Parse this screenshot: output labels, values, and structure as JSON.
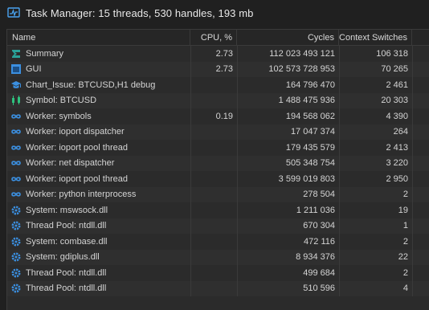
{
  "window": {
    "title": "Task Manager: 15 threads, 530 handles, 193 mb"
  },
  "columns": {
    "name": "Name",
    "cpu": "CPU, %",
    "cycles": "Cycles",
    "context_switches": "Context Switches"
  },
  "rows": [
    {
      "name": "Summary",
      "cpu": "2.73",
      "cycles": "112 023 493 121",
      "ctx": "106 318",
      "icon": "summary-icon"
    },
    {
      "name": "GUI",
      "cpu": "2.73",
      "cycles": "102 573 728 953",
      "ctx": "70 265",
      "icon": "gui-icon"
    },
    {
      "name": "Chart_Issue: BTCUSD,H1 debug",
      "cpu": "",
      "cycles": "164 796 470",
      "ctx": "2 461",
      "icon": "graduation-cap-icon"
    },
    {
      "name": "Symbol: BTCUSD",
      "cpu": "",
      "cycles": "1 488 475 936",
      "ctx": "20 303",
      "icon": "symbol-icon"
    },
    {
      "name": "Worker: symbols",
      "cpu": "0.19",
      "cycles": "194 568 062",
      "ctx": "4 390",
      "icon": "infinity-icon"
    },
    {
      "name": "Worker: ioport dispatcher",
      "cpu": "",
      "cycles": "17 047 374",
      "ctx": "264",
      "icon": "infinity-icon"
    },
    {
      "name": "Worker: ioport pool thread",
      "cpu": "",
      "cycles": "179 435 579",
      "ctx": "2 413",
      "icon": "infinity-icon"
    },
    {
      "name": "Worker: net dispatcher",
      "cpu": "",
      "cycles": "505 348 754",
      "ctx": "3 220",
      "icon": "infinity-icon"
    },
    {
      "name": "Worker: ioport pool thread",
      "cpu": "",
      "cycles": "3 599 019 803",
      "ctx": "2 950",
      "icon": "infinity-icon"
    },
    {
      "name": "Worker: python interprocess",
      "cpu": "",
      "cycles": "278 504",
      "ctx": "2",
      "icon": "infinity-icon"
    },
    {
      "name": "System: mswsock.dll",
      "cpu": "",
      "cycles": "1 211 036",
      "ctx": "19",
      "icon": "gear-icon"
    },
    {
      "name": "Thread Pool: ntdll.dll",
      "cpu": "",
      "cycles": "670 304",
      "ctx": "1",
      "icon": "gear-icon"
    },
    {
      "name": "System: combase.dll",
      "cpu": "",
      "cycles": "472 116",
      "ctx": "2",
      "icon": "gear-icon"
    },
    {
      "name": "System: gdiplus.dll",
      "cpu": "",
      "cycles": "8 934 376",
      "ctx": "22",
      "icon": "gear-icon"
    },
    {
      "name": "Thread Pool: ntdll.dll",
      "cpu": "",
      "cycles": "499 684",
      "ctx": "2",
      "icon": "gear-icon"
    },
    {
      "name": "Thread Pool: ntdll.dll",
      "cpu": "",
      "cycles": "510 596",
      "ctx": "4",
      "icon": "gear-icon"
    }
  ],
  "colors": {
    "icon_blue": "#3b8fe0",
    "icon_green": "#2ec27e",
    "summary_teal": "#2aa198"
  }
}
